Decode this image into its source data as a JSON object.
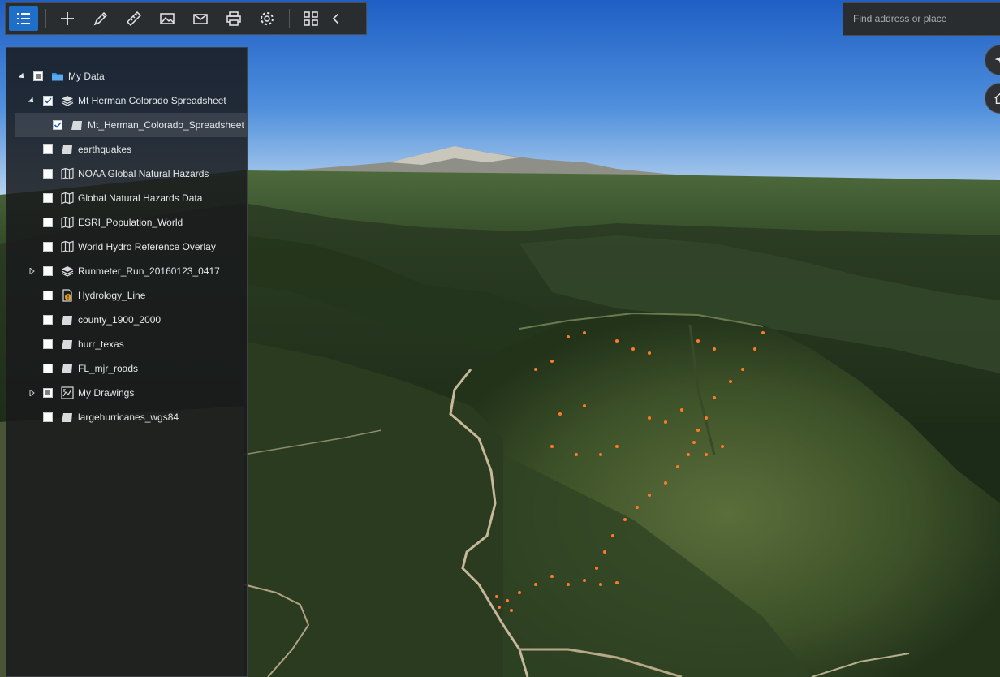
{
  "toolbar": {
    "buttons": [
      {
        "name": "layers-list-button",
        "icon": "list-icon",
        "active": true
      },
      {
        "name": "add-data-button",
        "icon": "plus-icon"
      },
      {
        "name": "draw-button",
        "icon": "pencil-icon"
      },
      {
        "name": "measure-button",
        "icon": "ruler-icon"
      },
      {
        "name": "basemap-button",
        "icon": "image-icon"
      },
      {
        "name": "share-button",
        "icon": "mail-icon"
      },
      {
        "name": "print-button",
        "icon": "printer-icon"
      },
      {
        "name": "settings-button",
        "icon": "gear-icon"
      },
      {
        "name": "apps-button",
        "icon": "grid-icon"
      },
      {
        "name": "collapse-toolbar-button",
        "icon": "chevron-left-icon"
      }
    ]
  },
  "search": {
    "placeholder": "Find address or place"
  },
  "colors": {
    "accent": "#1f6fc9",
    "panel": "#1a1c1e",
    "track": "#ff7a2a"
  },
  "layers": {
    "items": [
      {
        "label": "My Data",
        "indent": 0,
        "expander": "expanded",
        "check": "partial",
        "icon": "folder-icon"
      },
      {
        "label": "Mt Herman Colorado Spreadsheet",
        "indent": 1,
        "expander": "expanded",
        "check": "checked",
        "icon": "layers-icon"
      },
      {
        "label": "Mt_Herman_Colorado_Spreadsheet",
        "indent": 2,
        "expander": "none",
        "check": "checked",
        "icon": "polygon-icon",
        "selected": true
      },
      {
        "label": "earthquakes",
        "indent": 1,
        "expander": "none",
        "check": "unchecked",
        "icon": "polygon-icon"
      },
      {
        "label": "NOAA Global Natural Hazards",
        "indent": 1,
        "expander": "none",
        "check": "unchecked",
        "icon": "map-icon"
      },
      {
        "label": "Global Natural Hazards Data",
        "indent": 1,
        "expander": "none",
        "check": "unchecked",
        "icon": "map-icon"
      },
      {
        "label": "ESRI_Population_World",
        "indent": 1,
        "expander": "none",
        "check": "unchecked",
        "icon": "map-icon"
      },
      {
        "label": "World Hydro Reference Overlay",
        "indent": 1,
        "expander": "none",
        "check": "unchecked",
        "icon": "map-icon"
      },
      {
        "label": "Runmeter_Run_20160123_0417",
        "indent": 1,
        "expander": "collapsed",
        "check": "unchecked",
        "icon": "layers-icon"
      },
      {
        "label": "Hydrology_Line",
        "indent": 1,
        "expander": "none",
        "check": "unchecked",
        "icon": "warning-doc-icon"
      },
      {
        "label": "county_1900_2000",
        "indent": 1,
        "expander": "none",
        "check": "unchecked",
        "icon": "polygon-icon"
      },
      {
        "label": "hurr_texas",
        "indent": 1,
        "expander": "none",
        "check": "unchecked",
        "icon": "polygon-icon"
      },
      {
        "label": "FL_mjr_roads",
        "indent": 1,
        "expander": "none",
        "check": "unchecked",
        "icon": "polygon-icon"
      },
      {
        "label": "My Drawings",
        "indent": 1,
        "expander": "collapsed",
        "check": "partial",
        "icon": "drawing-icon"
      },
      {
        "label": "largehurricanes_wgs84",
        "indent": 1,
        "expander": "none",
        "check": "unchecked",
        "icon": "polygon-icon"
      }
    ]
  }
}
